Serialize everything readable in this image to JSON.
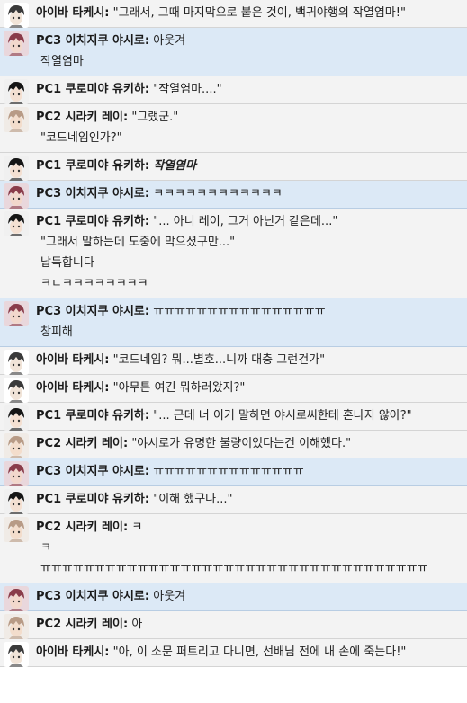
{
  "messages": [
    {
      "speaker": "아이바 타케시:",
      "avatar": "takeshi",
      "text": "\"그래서, 그때 마지막으로 붙은 것이, 백귀야행의 작열염마!\"",
      "extra": []
    },
    {
      "speaker": "PC3 이치지쿠 야시로:",
      "avatar": "yashiro",
      "text": "아웃겨",
      "extra": [
        "작열염마"
      ]
    },
    {
      "speaker": "PC1 쿠로미야 유키하:",
      "avatar": "yukiha",
      "text": "\"작열염마....\"",
      "extra": []
    },
    {
      "speaker": "PC2 시라키 레이:",
      "avatar": "rei",
      "text": "\"그랬군.\"",
      "extra": [
        "\"코드네임인가?\""
      ]
    },
    {
      "speaker": "PC1 쿠로미야 유키하:",
      "avatar": "yukiha",
      "text": "작열염마",
      "emph": true,
      "extra": []
    },
    {
      "speaker": "PC3 이치지쿠 야시로:",
      "avatar": "yashiro",
      "text": "ㅋㅋㅋㅋㅋㅋㅋㅋㅋㅋㅋㅋ",
      "extra": []
    },
    {
      "speaker": "PC1 쿠로미야 유키하:",
      "avatar": "yukiha",
      "text": "\"... 아니 레이, 그거 아닌거 같은데...\"",
      "extra": [
        "\"그래서 말하는데 도중에 막으셨구만...\"",
        "납득합니다",
        "ㅋㄷㅋㅋㅋㅋㅋㅋㅋㅋ"
      ]
    },
    {
      "speaker": "PC3 이치지쿠 야시로:",
      "avatar": "yashiro",
      "text": "ㅠㅠㅠㅠㅠㅠㅠㅠㅠㅠㅠㅠㅠㅠㅠㅠ",
      "extra": [
        "창피해"
      ]
    },
    {
      "speaker": "아이바 타케시:",
      "avatar": "takeshi",
      "text": "\"코드네임? 뭐...별호...니까 대충 그런건가\"",
      "extra": []
    },
    {
      "speaker": "아이바 타케시:",
      "avatar": "takeshi",
      "text": "\"아무튼 여긴 뭐하러왔지?\"",
      "extra": []
    },
    {
      "speaker": "PC1 쿠로미야 유키하:",
      "avatar": "yukiha",
      "text": "\"... 근데 너 이거 말하면 야시로씨한테 혼나지 않아?\"",
      "extra": []
    },
    {
      "speaker": "PC2 시라키 레이:",
      "avatar": "rei",
      "text": "\"야시로가 유명한 불량이었다는건 이해했다.\"",
      "extra": []
    },
    {
      "speaker": "PC3 이치지쿠 야시로:",
      "avatar": "yashiro",
      "text": "ㅠㅠㅠㅠㅠㅠㅠㅠㅠㅠㅠㅠㅠㅠ",
      "extra": []
    },
    {
      "speaker": "PC1 쿠로미야 유키하:",
      "avatar": "yukiha",
      "text": "\"이해 했구나...\"",
      "extra": []
    },
    {
      "speaker": "PC2 시라키 레이:",
      "avatar": "rei",
      "text": "ㅋ",
      "extra": [
        "ㅋ",
        "ㅠㅠㅠㅠㅠㅠㅠㅠㅠㅠㅠㅠㅠㅠㅠㅠㅠㅠㅠㅠㅠㅠㅠㅠㅠㅠㅠㅠㅠㅠㅠㅠㅠㅠㅠㅠ"
      ]
    },
    {
      "speaker": "PC3 이치지쿠 야시로:",
      "avatar": "yashiro",
      "text": "아웃겨",
      "extra": []
    },
    {
      "speaker": "PC2 시라키 레이:",
      "avatar": "rei",
      "text": "아",
      "extra": []
    },
    {
      "speaker": "아이바 타케시:",
      "avatar": "takeshi",
      "text": "\"아, 이 소문 퍼트리고 다니면, 선배님 전에 내 손에 죽는다!\"",
      "extra": []
    }
  ],
  "avatars": {
    "takeshi": {
      "hair": "#3a3a3a",
      "bg": "#ffffff",
      "skin": "#f1e4d8"
    },
    "yashiro": {
      "hair": "#8a3c4a",
      "bg": "#e9d7dc",
      "skin": "#f2d8cc"
    },
    "yukiha": {
      "hair": "#151515",
      "bg": "#f0f0f0",
      "skin": "#f4e0d2"
    },
    "rei": {
      "hair": "#b89b86",
      "bg": "#f0ebe6",
      "skin": "#f3ddcc"
    }
  }
}
